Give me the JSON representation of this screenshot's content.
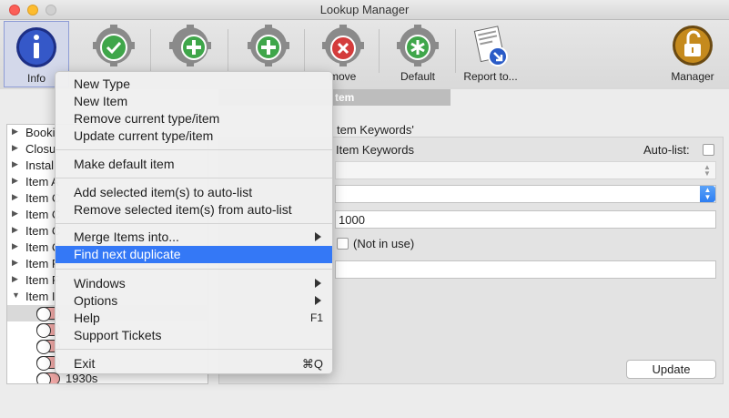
{
  "window": {
    "title": "Lookup Manager"
  },
  "toolbar": {
    "buttons": [
      {
        "label": "Info",
        "icon": "info-icon"
      },
      {
        "label": "",
        "icon": "gear-check-icon"
      },
      {
        "label": "",
        "icon": "gear-add-icon"
      },
      {
        "label": "",
        "icon": "gear-add-icon"
      },
      {
        "label": "move",
        "icon": "gear-remove-icon"
      },
      {
        "label": "Default",
        "icon": "gear-star-icon"
      },
      {
        "label": "Report to...",
        "icon": "report-icon"
      },
      {
        "label": "Manager",
        "icon": "unlock-icon"
      }
    ],
    "tab_label": "tem"
  },
  "tree": {
    "items": [
      {
        "label": "Booki"
      },
      {
        "label": "Closu"
      },
      {
        "label": "Instal"
      },
      {
        "label": "Item A"
      },
      {
        "label": "Item C"
      },
      {
        "label": "Item C"
      },
      {
        "label": "Item C"
      },
      {
        "label": "Item C"
      },
      {
        "label": "Item F"
      },
      {
        "label": "Item F"
      },
      {
        "label": "Item I"
      }
    ],
    "children": [
      {
        "label": ""
      },
      {
        "label": ""
      },
      {
        "label": ""
      },
      {
        "label": ""
      },
      {
        "label": "1930s"
      }
    ]
  },
  "detail": {
    "heading": "tem Keywords'",
    "type_label": "Item Keywords",
    "autolist_label": "Auto-list:",
    "number_value": "1000",
    "not_in_use_label": "(Not in use)",
    "update_label": "Update"
  },
  "menu": {
    "items": [
      {
        "label": "New Type",
        "shortcut": ""
      },
      {
        "label": "New Item",
        "shortcut": ""
      },
      {
        "label": "Remove current type/item",
        "shortcut": ""
      },
      {
        "label": "Update current type/item",
        "shortcut": ""
      },
      {
        "label": "Make default item",
        "shortcut": ""
      },
      {
        "label": "Add selected item(s) to auto-list",
        "shortcut": ""
      },
      {
        "label": "Remove selected item(s) from auto-list",
        "shortcut": ""
      },
      {
        "label": "Merge Items into...",
        "shortcut": ""
      },
      {
        "label": "Find next duplicate",
        "shortcut": ""
      },
      {
        "label": "Windows",
        "shortcut": ""
      },
      {
        "label": "Options",
        "shortcut": ""
      },
      {
        "label": "Help",
        "shortcut": "F1"
      },
      {
        "label": "Support Tickets",
        "shortcut": ""
      },
      {
        "label": "Exit",
        "shortcut": "⌘Q"
      }
    ]
  },
  "colors": {
    "highlight": "#3478f6",
    "gear_green": "#3fa64a",
    "gear_red": "#d43c3c",
    "info_blue": "#2f4fb8",
    "manager_gold": "#c58a1d"
  }
}
